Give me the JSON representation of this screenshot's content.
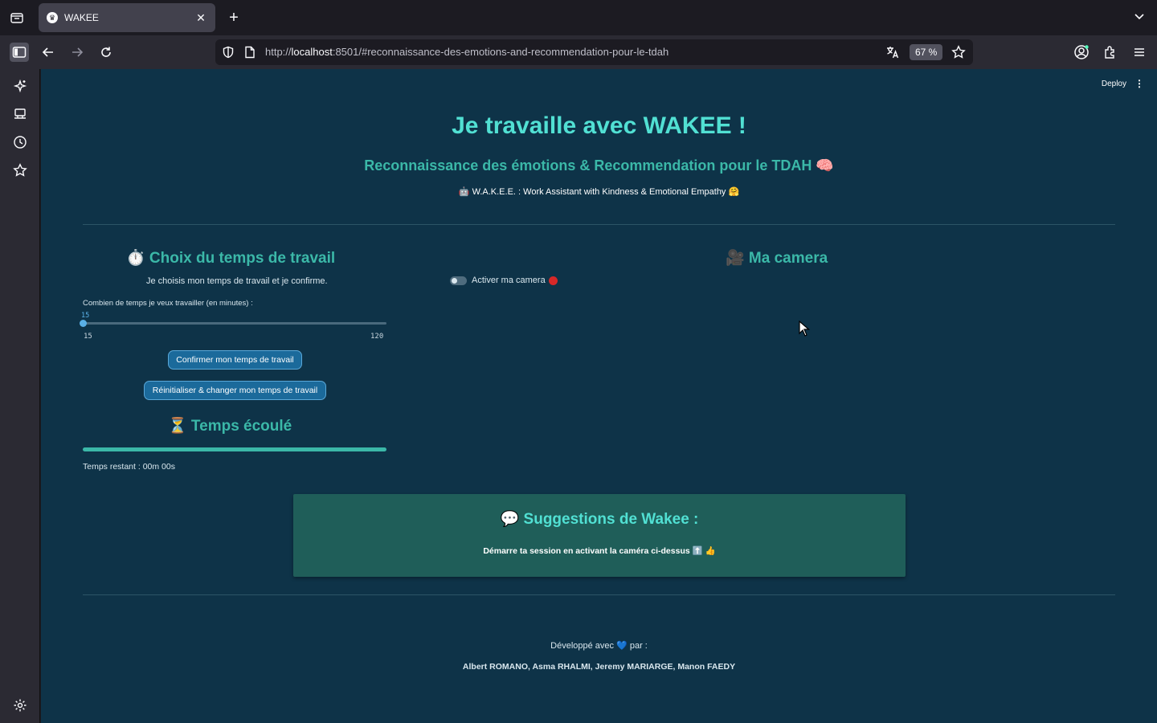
{
  "browser": {
    "tab": {
      "title": "WAKEE",
      "favicon": "crown-icon"
    },
    "url": {
      "prefix": "http://",
      "host": "localhost",
      "rest": ":8501/#reconnaissance-des-emotions-and-recommendation-pour-le-tdah"
    },
    "zoom": "67 %"
  },
  "app": {
    "deploy_label": "Deploy",
    "kebab_label": "⋮",
    "title": "Je travaille avec WAKEE !",
    "subtitle": "Reconnaissance des émotions & Recommendation pour le TDAH 🧠",
    "tagline": "🤖 W.A.K.E.E. : Work Assistant with Kindness & Emotional Empathy 🤗"
  },
  "work": {
    "title": "⏱️ Choix du temps de travail",
    "description": "Je choisis mon temps de travail et je confirme.",
    "slider_label": "Combien de temps je veux travailler (en minutes) :",
    "slider_value": "15",
    "slider_value_num": 15,
    "slider_min": "15",
    "slider_max": "120",
    "slider_min_num": 15,
    "slider_max_num": 120,
    "confirm_button": "Confirmer mon temps de travail",
    "reset_button": "Réinitialiser & changer mon temps de travail"
  },
  "elapsed": {
    "title": "⏳ Temps écoulé",
    "progress": 1,
    "remaining": "Temps restant : 00m 00s"
  },
  "camera": {
    "title": "🎥 Ma camera",
    "toggle_label": "Activer ma camera",
    "toggle_on": false
  },
  "suggestions": {
    "title": "💬 Suggestions de Wakee :",
    "text": "Démarre ta session en activant la caméra ci-dessus ⬆️ 👍"
  },
  "footer": {
    "made_with": "Développé avec 💙 par :",
    "authors": "Albert ROMANO, Asma RHALMI, Jeremy MARIARGE, Manon FAEDY"
  },
  "colors": {
    "background": "#0e3348",
    "heading": "#51e0d3",
    "accent": "#3bb8a8",
    "button": "#1b6a9b",
    "suggestion_box": "#1f5e59"
  }
}
